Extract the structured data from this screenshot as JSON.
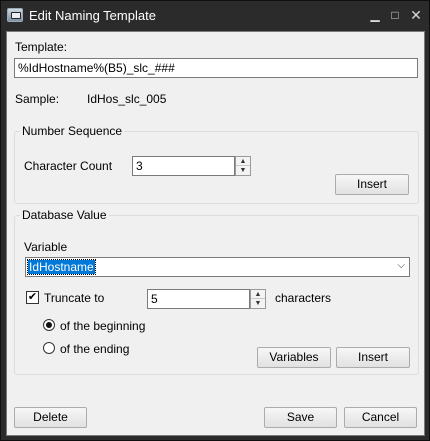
{
  "window": {
    "title": "Edit Naming Template",
    "minimize": "▁",
    "maximize": "□",
    "close": "✕"
  },
  "template": {
    "label": "Template:",
    "value": "%IdHostname%(B5)_slc_###"
  },
  "sample": {
    "label": "Sample:",
    "value": "IdHos_slc_005"
  },
  "number_sequence": {
    "title": "Number Sequence",
    "character_count_label": "Character Count",
    "character_count_value": "3",
    "insert_label": "Insert"
  },
  "database_value": {
    "title": "Database Value",
    "variable_label": "Variable",
    "variable_value": "IdHostname",
    "truncate_label": "Truncate to",
    "truncate_checked": true,
    "truncate_value": "5",
    "characters_label": "characters",
    "of_beginning_label": "of the beginning",
    "of_ending_label": "of the ending",
    "selected_option": "beginning",
    "variables_button": "Variables",
    "insert_label": "Insert"
  },
  "footer": {
    "delete_label": "Delete",
    "save_label": "Save",
    "cancel_label": "Cancel"
  }
}
